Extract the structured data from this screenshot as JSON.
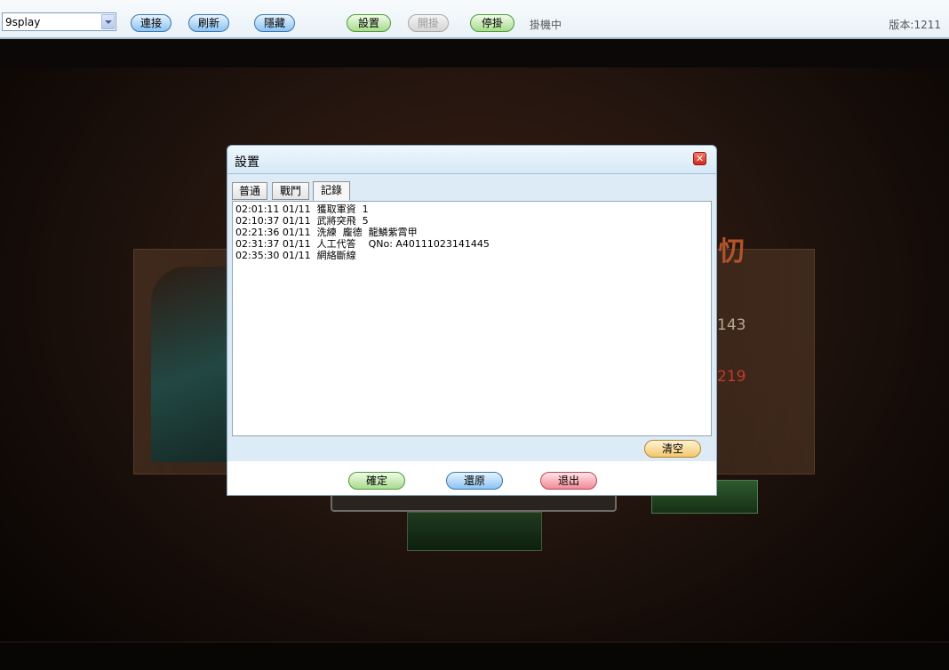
{
  "toolbar": {
    "server_value": "9splay",
    "buttons": {
      "connect": "連接",
      "refresh": "刷新",
      "hide": "隱藏",
      "settings": "設置",
      "start": "開掛",
      "stop": "停掛"
    },
    "status": "掛機中",
    "version": "版本:1211"
  },
  "background": {
    "numbers": [
      "143",
      "219"
    ]
  },
  "dialog": {
    "title": "設置",
    "tabs": [
      "普通",
      "戰鬥",
      "記錄"
    ],
    "active_tab": "記錄",
    "log": [
      "02:01:11 01/11  獲取軍資  1",
      "02:10:37 01/11  武將突飛  5",
      "02:21:36 01/11  洗練  龐德  龍鱗紫霄甲",
      "02:31:37 01/11  人工代答    QNo: A40111023141445",
      "02:35:30 01/11  網絡斷線"
    ],
    "clear_label": "清空",
    "confirm_label": "確定",
    "restore_label": "還原",
    "exit_label": "退出"
  },
  "colors": {
    "accent_blue": "#8cc3f2",
    "accent_green": "#a7dc8c",
    "accent_red": "#f28a98",
    "accent_orange": "#f3c76c"
  }
}
